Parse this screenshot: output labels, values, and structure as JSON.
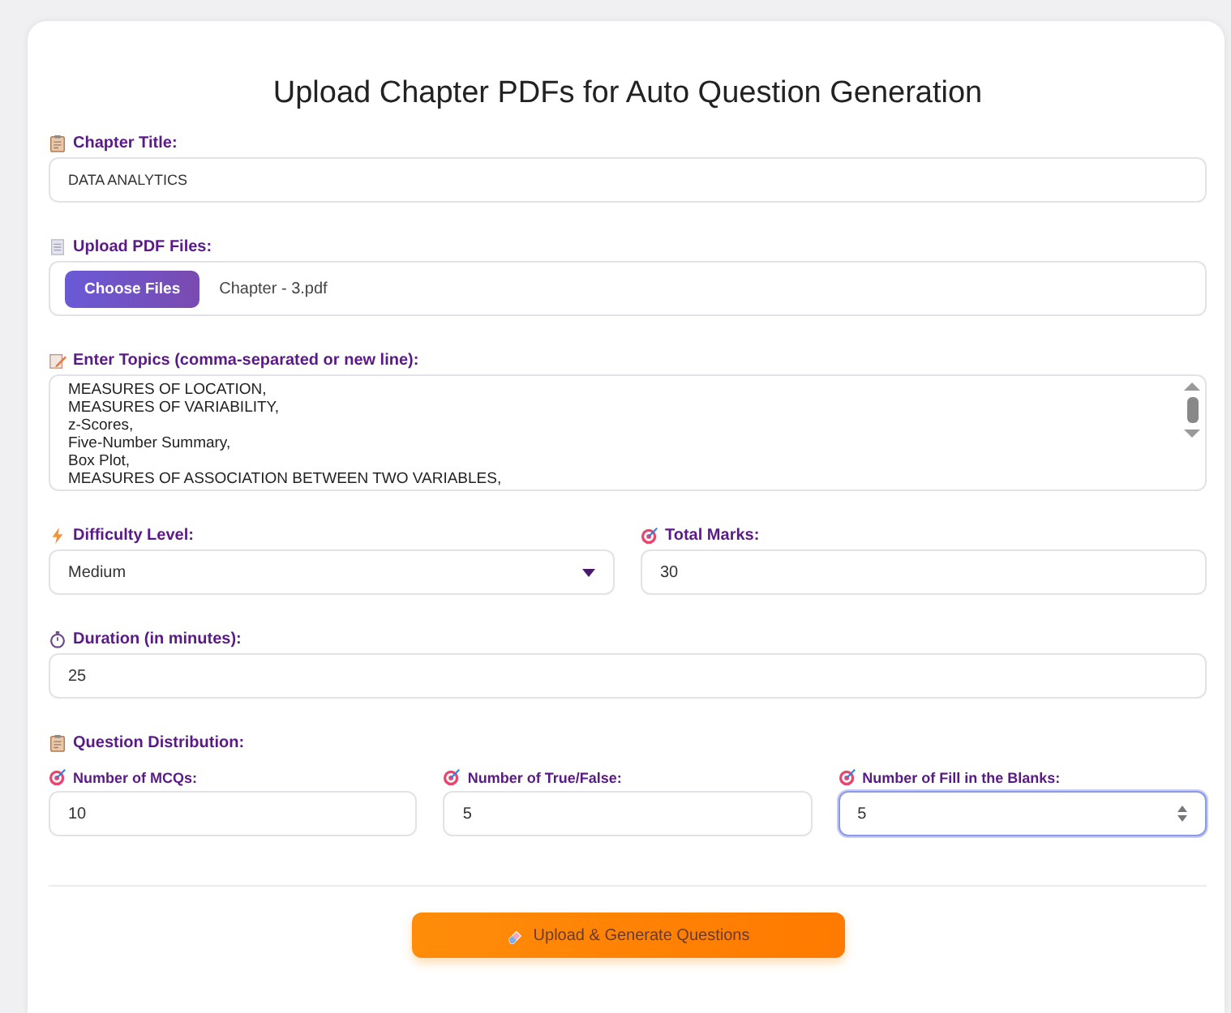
{
  "title": "Upload Chapter PDFs for Auto Question Generation",
  "chapter_title": {
    "label": "Chapter Title:",
    "value": "DATA ANALYTICS"
  },
  "upload": {
    "label": "Upload PDF Files:",
    "button": "Choose Files",
    "file_name": "Chapter - 3.pdf"
  },
  "topics": {
    "label": "Enter Topics (comma-separated or new line):",
    "lines": [
      "MEASURES OF LOCATION,",
      "MEASURES OF VARIABILITY,",
      "z-Scores,",
      "Five-Number Summary,",
      "Box Plot,",
      "MEASURES OF ASSOCIATION BETWEEN TWO VARIABLES,"
    ]
  },
  "difficulty": {
    "label": "Difficulty Level:",
    "value": "Medium"
  },
  "total_marks": {
    "label": "Total Marks:",
    "value": "30"
  },
  "duration": {
    "label": "Duration (in minutes):",
    "value": "25"
  },
  "distribution": {
    "label": "Question Distribution:",
    "fields": [
      {
        "label": "Number of MCQs:",
        "value": "10",
        "focused": false
      },
      {
        "label": "Number of True/False:",
        "value": "5",
        "focused": false
      },
      {
        "label": "Number of Fill in the Blanks:",
        "value": "5",
        "focused": true
      }
    ]
  },
  "submit": {
    "label": "Upload & Generate Questions"
  }
}
